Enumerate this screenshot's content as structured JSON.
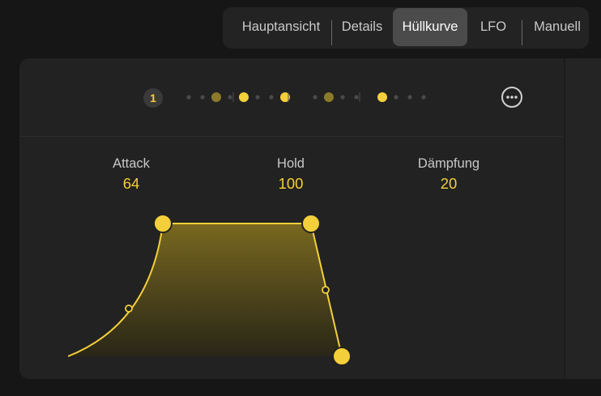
{
  "tabs": [
    {
      "label": "Hauptansicht",
      "active": false
    },
    {
      "label": "Details",
      "active": false
    },
    {
      "label": "Hüllkurve",
      "active": true
    },
    {
      "label": "LFO",
      "active": false
    },
    {
      "label": "Manuell",
      "active": false
    }
  ],
  "pages": {
    "current": "1",
    "more_icon": "ellipsis-circle-icon"
  },
  "step_indicator": {
    "groups": [
      [
        "dim",
        "dim",
        "mid",
        "dim"
      ],
      [
        "bright",
        "dim",
        "dim",
        "bright"
      ],
      [
        "dim",
        "mid",
        "dim",
        "dim"
      ],
      [
        "bright",
        "dim",
        "dim",
        "dim"
      ]
    ]
  },
  "params": {
    "attack": {
      "label": "Attack",
      "value": "64"
    },
    "hold": {
      "label": "Hold",
      "value": "100"
    },
    "decay": {
      "label": "Dämpfung",
      "value": "20"
    }
  },
  "colors": {
    "accent": "#f3cf3a",
    "dot_mid": "#8b7a2a",
    "dot_dim": "#4a4a4a",
    "panel": "#222222",
    "background": "#161616"
  }
}
